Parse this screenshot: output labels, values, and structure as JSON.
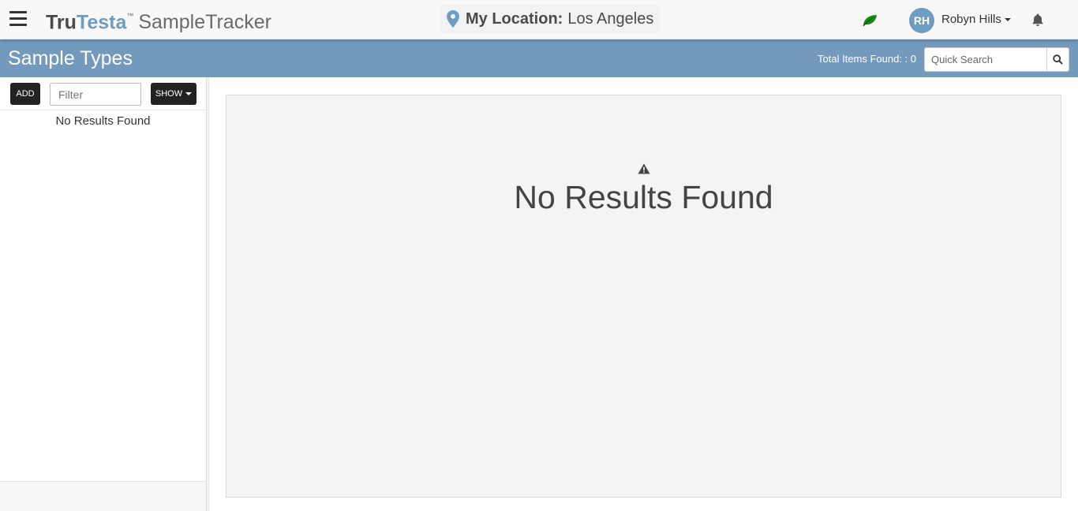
{
  "header": {
    "brand_tru": "Tru",
    "brand_testa": "Testa",
    "brand_tm": "™",
    "app_name": "SampleTracker",
    "location_label": "My Location:",
    "location_value": "Los Angeles",
    "user_initials": "RH",
    "user_name": "Robyn Hills",
    "leaf_color": "#1a8a1a",
    "accent_color": "#6f9cc1"
  },
  "page": {
    "title": "Sample Types",
    "total_items": "Total Items Found: : 0",
    "quick_search_placeholder": "Quick Search",
    "bar_color": "#7399bc"
  },
  "sidebar": {
    "add_label": "ADD",
    "filter_placeholder": "Filter",
    "show_label": "SHOW",
    "empty_text": "No Results Found"
  },
  "main": {
    "empty_text": "No Results Found"
  }
}
